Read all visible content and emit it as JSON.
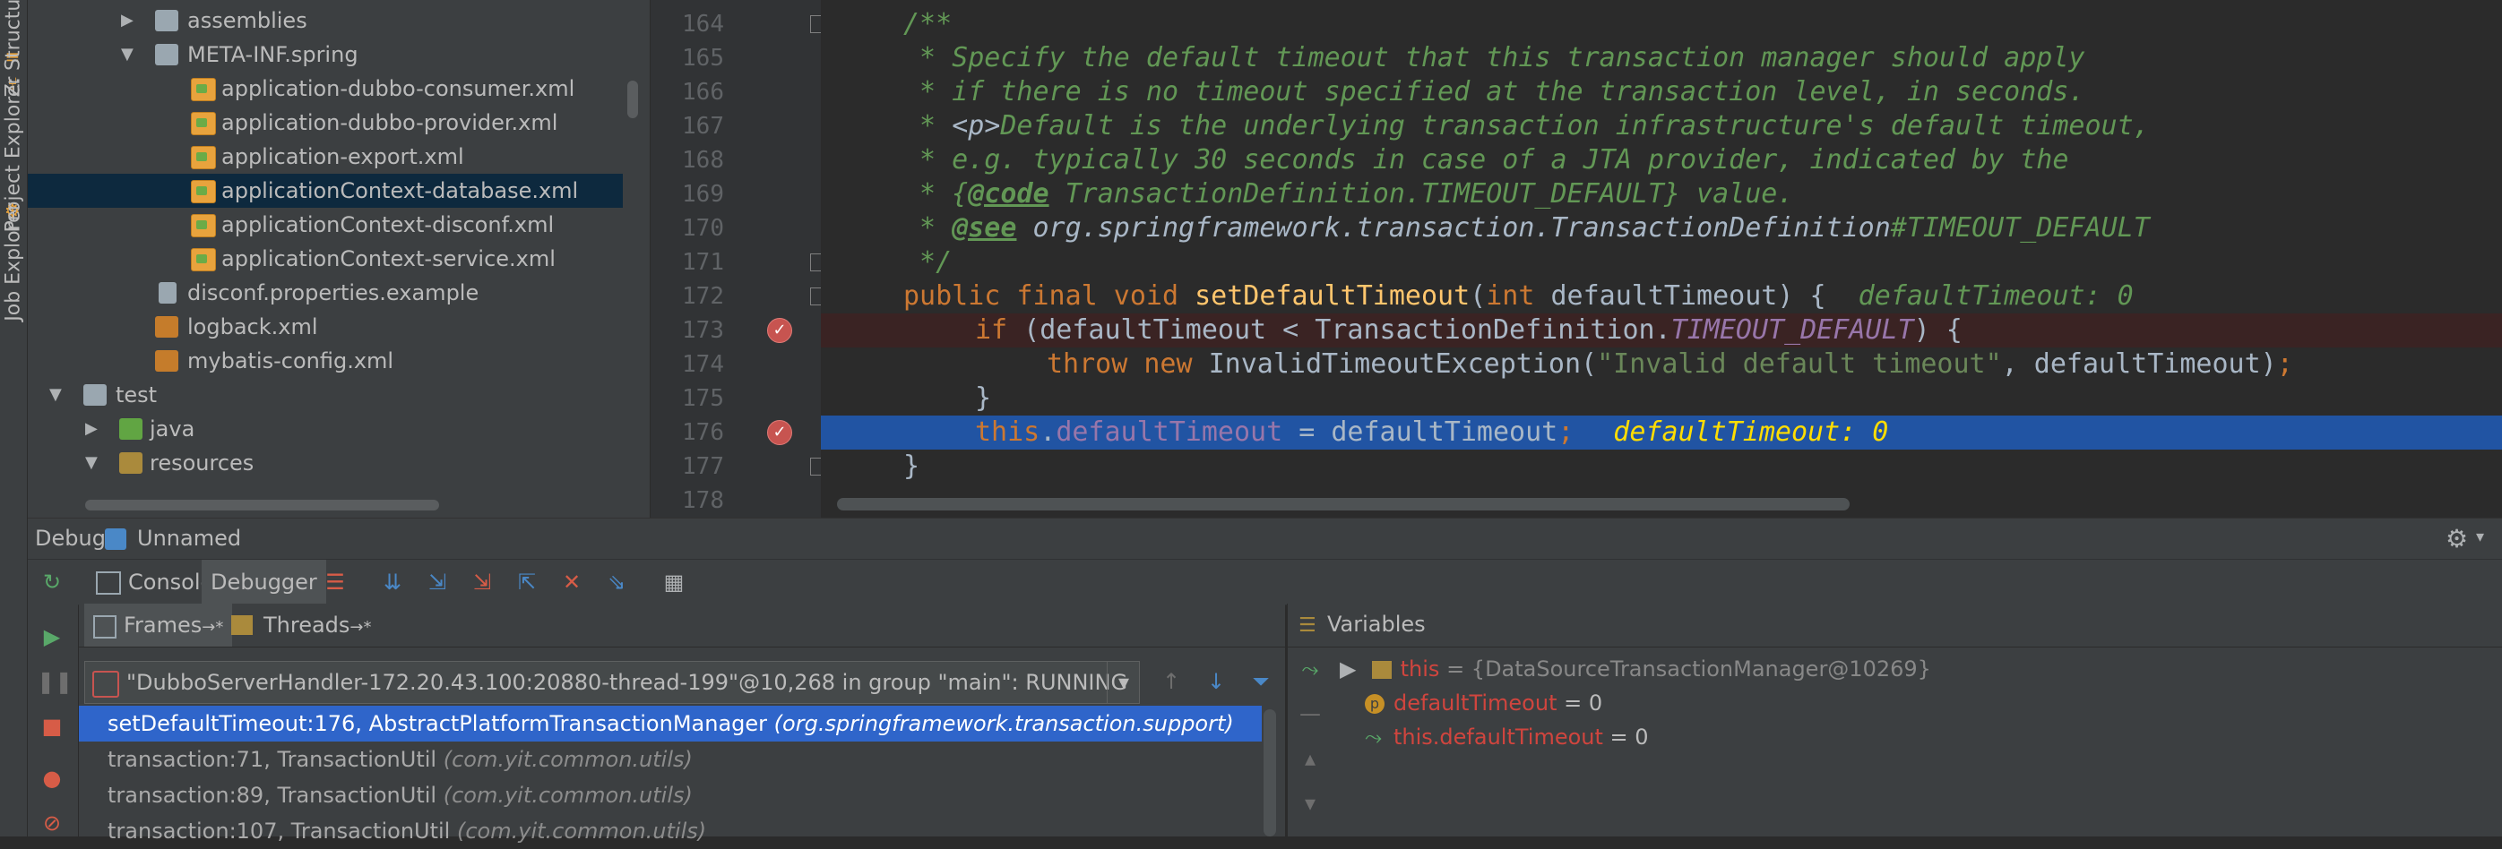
{
  "left_strip": {
    "tabs": [
      "Z: Structure",
      "Project Explorer",
      "Job Explorer"
    ]
  },
  "project_tree": [
    {
      "label": "assemblies",
      "type": "folder",
      "arrow": "collapsed"
    },
    {
      "label": "META-INF.spring",
      "type": "folder",
      "arrow": "expanded"
    },
    {
      "label": "application-dubbo-consumer.xml",
      "type": "xml"
    },
    {
      "label": "application-dubbo-provider.xml",
      "type": "xml"
    },
    {
      "label": "application-export.xml",
      "type": "xml"
    },
    {
      "label": "applicationContext-database.xml",
      "type": "xml",
      "selected": true
    },
    {
      "label": "applicationContext-disconf.xml",
      "type": "xml"
    },
    {
      "label": "applicationContext-service.xml",
      "type": "xml"
    },
    {
      "label": "disconf.properties.example",
      "type": "props"
    },
    {
      "label": "logback.xml",
      "type": "cfgxml"
    },
    {
      "label": "mybatis-config.xml",
      "type": "cfgxml"
    },
    {
      "label": "test",
      "type": "folder",
      "arrow": "expanded"
    },
    {
      "label": "java",
      "type": "folder-green",
      "arrow": "collapsed"
    },
    {
      "label": "resources",
      "type": "folder-res",
      "arrow": "expanded"
    }
  ],
  "editor": {
    "line_numbers": [
      "164",
      "165",
      "166",
      "167",
      "168",
      "169",
      "170",
      "171",
      "172",
      "173",
      "174",
      "175",
      "176",
      "177",
      "178"
    ],
    "doc": {
      "l164": "/**",
      "l165": " * Specify the default timeout that this transaction manager should apply",
      "l166": " * if there is no timeout specified at the transaction level, in seconds.",
      "l167_a": " * ",
      "l167_tag": "<p>",
      "l167_b": "Default is the underlying transaction infrastructure's default timeout,",
      "l168": " * e.g. typically 30 seconds in case of a JTA provider, indicated by the",
      "l169_a": " * {",
      "l169_tag": "@code",
      "l169_b": " TransactionDefinition.TIMEOUT_DEFAULT} value.",
      "l170_a": " * ",
      "l170_tag": "@see",
      "l170_ref": " org.springframework.transaction.TransactionDefinition",
      "l170_b": "#TIMEOUT_DEFAULT",
      "l171": " */"
    },
    "l172": {
      "kw": "public final void ",
      "fn": "setDefaultTimeout",
      "rest": "(",
      "kw2": "int",
      "rest2": " defaultTimeout) {  ",
      "inline": "defaultTimeout: 0"
    },
    "l173": {
      "kw": "if",
      "rest": " (defaultTimeout < TransactionDefinition.",
      "sfld": "TIMEOUT_DEFAULT",
      "rest2": ") {"
    },
    "l174": {
      "kw": "throw new",
      "rest": " InvalidTimeoutException(",
      "str": "\"Invalid default timeout\"",
      "rest2": ", defaultTimeout)",
      "semi": ";"
    },
    "l175": "}",
    "l176": {
      "kw": "this",
      "dot": ".",
      "fld": "defaultTimeout",
      "rest": " = defaultTimeout",
      "semi": ";",
      "inline": "defaultTimeout: 0"
    },
    "l177": "}"
  },
  "debug": {
    "title": "Debug",
    "config": "Unnamed",
    "tabs": [
      "Console",
      "Debugger"
    ],
    "frames_tab": "Frames",
    "threads_tab": "Threads",
    "tab_suffix": "→*",
    "thread": "\"DubboServerHandler-172.20.43.100:20880-thread-199\"@10,268 in group \"main\": RUNNING",
    "frames": [
      {
        "method": "setDefaultTimeout:176, AbstractPlatformTransactionManager",
        "pkg": "(org.springframework.transaction.support)",
        "selected": true
      },
      {
        "method": "transaction:71, TransactionUtil",
        "pkg": "(com.yit.common.utils)"
      },
      {
        "method": "transaction:89, TransactionUtil",
        "pkg": "(com.yit.common.utils)"
      },
      {
        "method": "transaction:107, TransactionUtil",
        "pkg": "(com.yit.common.utils)"
      }
    ],
    "variables_title": "Variables",
    "variables": [
      {
        "name": "this",
        "value": " = {DataSourceTransactionManager@10269}"
      },
      {
        "name": "defaultTimeout",
        "value": " = 0"
      },
      {
        "name": "this.defaultTimeout",
        "value": " = 0"
      }
    ]
  },
  "colors": {
    "selection": "#2f65ca",
    "exec_line": "#2154a3",
    "breakpoint": "#c75450"
  }
}
